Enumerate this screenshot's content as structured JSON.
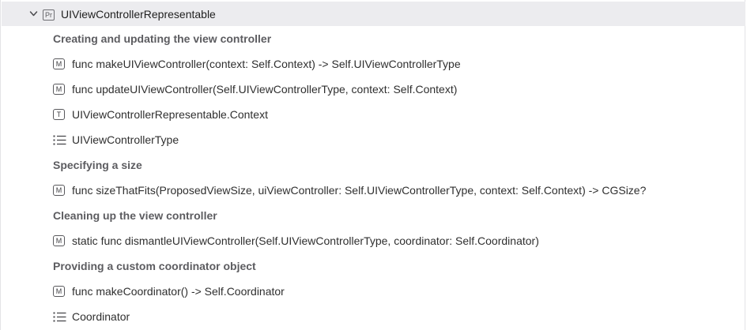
{
  "protocol": {
    "title": "UIViewControllerRepresentable",
    "icon": "protocol-icon",
    "icon_glyph": "Pr"
  },
  "rows": [
    {
      "kind": "section",
      "label": "Creating and updating the view controller"
    },
    {
      "kind": "member",
      "icon": "method-icon",
      "glyph": "M",
      "label": "func makeUIViewController(context: Self.Context) -> Self.UIViewControllerType"
    },
    {
      "kind": "member",
      "icon": "method-icon",
      "glyph": "M",
      "label": "func updateUIViewController(Self.UIViewControllerType, context: Self.Context)"
    },
    {
      "kind": "member",
      "icon": "type-alias-icon",
      "glyph": "T",
      "label": "UIViewControllerRepresentable.Context"
    },
    {
      "kind": "list",
      "icon": "associated-type-list-icon",
      "label": "UIViewControllerType"
    },
    {
      "kind": "section",
      "label": "Specifying a size"
    },
    {
      "kind": "member",
      "icon": "method-icon",
      "glyph": "M",
      "label": "func sizeThatFits(ProposedViewSize, uiViewController: Self.UIViewControllerType, context: Self.Context) -> CGSize?"
    },
    {
      "kind": "section",
      "label": "Cleaning up the view controller"
    },
    {
      "kind": "member",
      "icon": "method-icon",
      "glyph": "M",
      "label": "static func dismantleUIViewController(Self.UIViewControllerType, coordinator: Self.Coordinator)"
    },
    {
      "kind": "section",
      "label": "Providing a custom coordinator object"
    },
    {
      "kind": "member",
      "icon": "method-icon",
      "glyph": "M",
      "label": "func makeCoordinator() -> Self.Coordinator"
    },
    {
      "kind": "list",
      "icon": "associated-type-list-icon",
      "label": "Coordinator"
    }
  ]
}
